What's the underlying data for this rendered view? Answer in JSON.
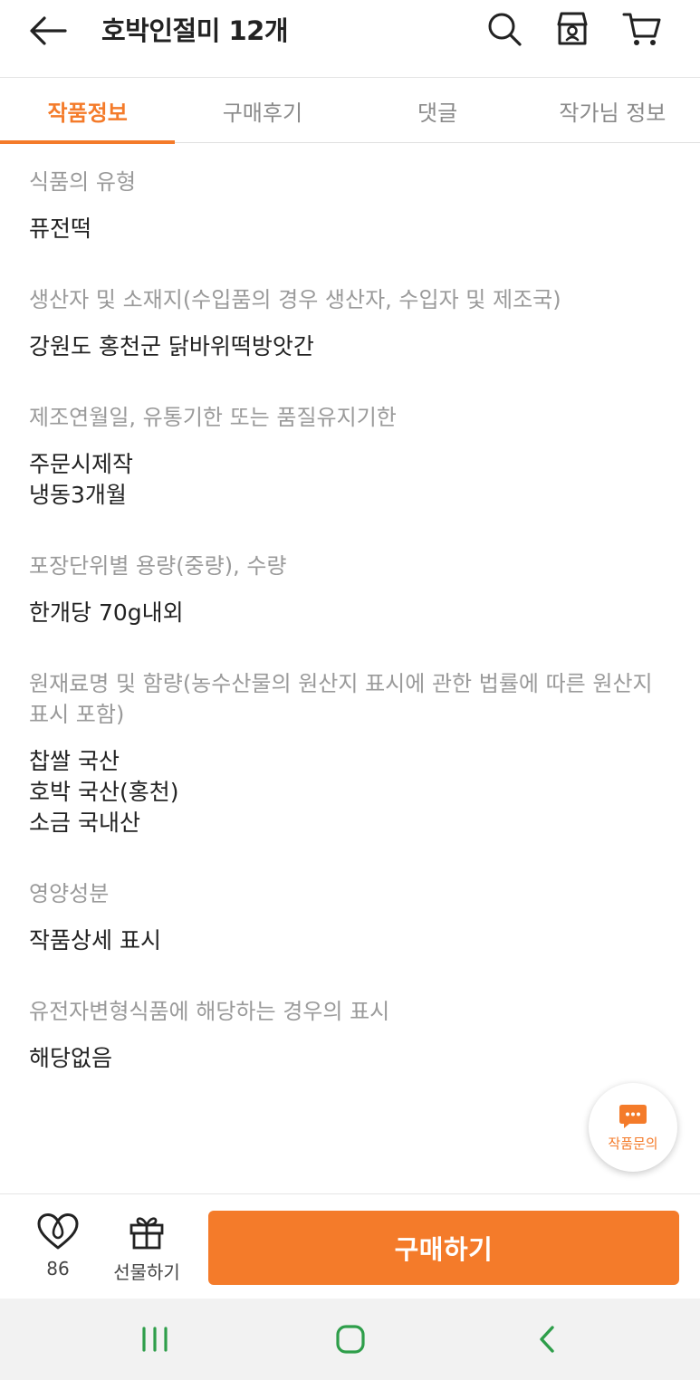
{
  "header": {
    "title": "호박인절미 12개",
    "icons": [
      "back-arrow-icon",
      "search-icon",
      "shop-icon",
      "cart-icon"
    ]
  },
  "tabs": [
    {
      "label": "작품정보",
      "active": true
    },
    {
      "label": "구매후기",
      "active": false
    },
    {
      "label": "댓글",
      "active": false
    },
    {
      "label": "작가님 정보",
      "active": false
    }
  ],
  "sections": [
    {
      "label": "식품의 유형",
      "values": [
        "퓨전떡"
      ]
    },
    {
      "label": "생산자 및 소재지(수입품의 경우 생산자, 수입자 및 제조국)",
      "values": [
        "강원도 홍천군 닭바위떡방앗간"
      ]
    },
    {
      "label": "제조연월일, 유통기한 또는 품질유지기한",
      "values": [
        "주문시제작",
        "냉동3개월"
      ]
    },
    {
      "label": "포장단위별 용량(중량), 수량",
      "values": [
        "한개당 70g내외"
      ]
    },
    {
      "label": "원재료명 및 함량(농수산물의 원산지 표시에 관한 법률에 따른 원산지 표시 포함)",
      "values": [
        "찹쌀 국산",
        "호박 국산(홍천)",
        "소금 국내산"
      ]
    },
    {
      "label": "영양성분",
      "values": [
        "작품상세 표시"
      ]
    },
    {
      "label": "유전자변형식품에 해당하는 경우의 표시",
      "values": [
        "해당없음"
      ]
    }
  ],
  "chat_fab": {
    "label": "작품문의"
  },
  "bottom_bar": {
    "like_count": "86",
    "gift_label": "선물하기",
    "buy_label": "구매하기"
  },
  "colors": {
    "accent": "#f47b2a",
    "nav_icon": "#2e9e4a"
  }
}
